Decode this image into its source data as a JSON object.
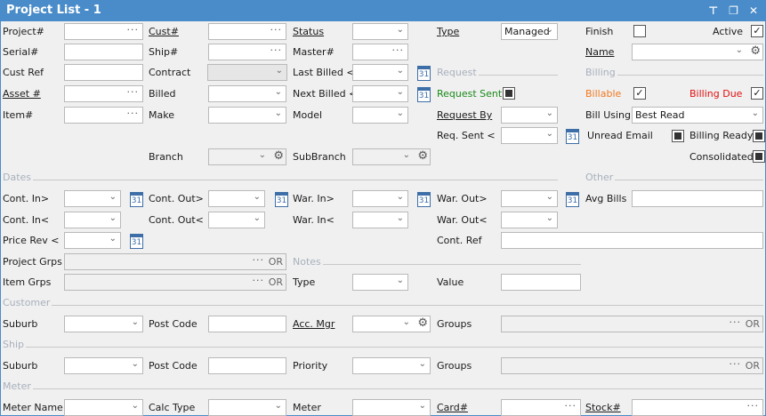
{
  "window": {
    "title": "Project List - 1",
    "pin_icon": "pin-icon",
    "restore_icon": "restore-icon",
    "close_icon": "close-icon"
  },
  "labels": {
    "project": "Project#",
    "cust": "Cust#",
    "status": "Status",
    "type": "Type",
    "finish": "Finish",
    "active": "Active",
    "serial": "Serial#",
    "ship": "Ship#",
    "master": "Master#",
    "name": "Name",
    "cust_ref": "Cust Ref",
    "contract": "Contract",
    "last_billed": "Last Billed <",
    "request": "Request",
    "billing": "Billing",
    "asset": "Asset #",
    "billed": "Billed",
    "next_billed": "Next Billed <",
    "request_sent": "Request Sent",
    "billable": "Billable",
    "billing_due": "Billing Due",
    "item": "Item#",
    "make": "Make",
    "model": "Model",
    "request_by": "Request By",
    "bill_using": "Bill Using",
    "req_sent": "Req. Sent <",
    "unread_email": "Unread Email",
    "billing_ready": "Billing Ready",
    "branch": "Branch",
    "subbranch": "SubBranch",
    "consolidated": "Consolidated",
    "dates": "Dates",
    "other": "Other",
    "cont_in_gt": "Cont. In>",
    "cont_out_gt": "Cont. Out>",
    "war_in_gt": "War. In>",
    "war_out_gt": "War. Out>",
    "avg_bills": "Avg Bills",
    "cont_in_lt": "Cont. In<",
    "cont_out_lt": "Cont. Out<",
    "war_in_lt": "War. In<",
    "war_out_lt": "War. Out<",
    "price_rev": "Price Rev <",
    "cont_ref": "Cont. Ref",
    "project_grps": "Project Grps",
    "notes": "Notes",
    "item_grps": "Item Grps",
    "notes_type": "Type",
    "value": "Value",
    "customer": "Customer",
    "suburb": "Suburb",
    "post_code": "Post Code",
    "acc_mgr": "Acc. Mgr",
    "groups": "Groups",
    "ship_sec": "Ship",
    "priority": "Priority",
    "meter_sec": "Meter",
    "meter_name": "Meter Name",
    "calc_type": "Calc Type",
    "meter": "Meter",
    "card": "Card#",
    "stock": "Stock#"
  },
  "values": {
    "type": "Managed",
    "bill_using": "Best Read",
    "or": "OR",
    "cal_day": "31"
  },
  "checkboxes": {
    "finish": false,
    "active": true,
    "request_sent": "indeterminate",
    "billable": true,
    "billing_due": true,
    "unread_email": "indeterminate",
    "billing_ready": "indeterminate",
    "consolidated": "indeterminate"
  },
  "colors": {
    "title_bar": "#4a8cc9",
    "request_sent": "#1a8a1a",
    "billable": "#f07820",
    "billing_due": "#e01010",
    "section": "#a8b0bc"
  }
}
